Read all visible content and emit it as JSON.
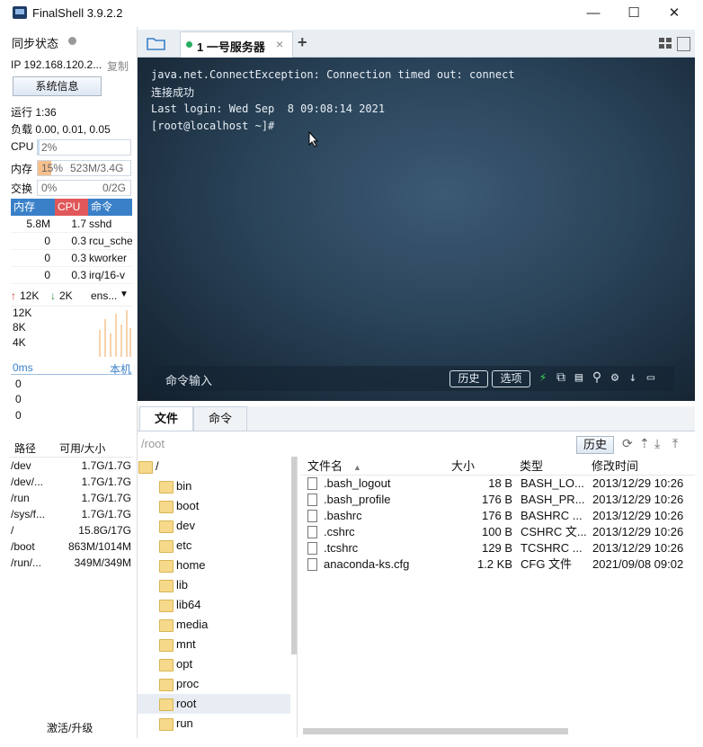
{
  "window": {
    "title": "FinalShell 3.9.2.2",
    "minimize": "—",
    "maximize": "☐",
    "close": "✕"
  },
  "left": {
    "sync_label": "同步状态",
    "ip": "IP 192.168.120.2...",
    "copy_label": "复制",
    "sysinfo_button": "系统信息",
    "uptime": "运行 1:36",
    "load": "负载 0.00, 0.01, 0.05",
    "cpu": {
      "label": "CPU",
      "value": "2%",
      "level": 0.02
    },
    "mem": {
      "label": "内存",
      "percent": "15%",
      "detail": "523M/3.4G",
      "level": 0.15
    },
    "swap": {
      "label": "交换",
      "percent": "0%",
      "detail": "0/2G",
      "level": 0
    },
    "process_headers": [
      "内存",
      "CPU",
      "命令"
    ],
    "processes": [
      {
        "mem": "5.8M",
        "cpu": "1.7",
        "cmd": "sshd"
      },
      {
        "mem": "0",
        "cpu": "0.3",
        "cmd": "rcu_sche"
      },
      {
        "mem": "0",
        "cpu": "0.3",
        "cmd": "kworker"
      },
      {
        "mem": "0",
        "cpu": "0.3",
        "cmd": "irq/16-v"
      }
    ],
    "net": {
      "up": "12K",
      "down": "2K",
      "iface": "ens...",
      "ticks": [
        "12K",
        "8K",
        "4K"
      ]
    },
    "latency": {
      "label": "0ms",
      "host": "本机",
      "ticks": [
        "0",
        "0",
        "0"
      ]
    },
    "disk_headers": [
      "路径",
      "可用/大小"
    ],
    "disks": [
      {
        "path": "/dev",
        "size": "1.7G/1.7G"
      },
      {
        "path": "/dev/...",
        "size": "1.7G/1.7G"
      },
      {
        "path": "/run",
        "size": "1.7G/1.7G"
      },
      {
        "path": "/sys/f...",
        "size": "1.7G/1.7G"
      },
      {
        "path": "/",
        "size": "15.8G/17G"
      },
      {
        "path": "/boot",
        "size": "863M/1014M"
      },
      {
        "path": "/run/...",
        "size": "349M/349M"
      }
    ],
    "activate": "激活/升级"
  },
  "tabs": {
    "active_label": "1 一号服务器",
    "close": "×",
    "add": "+"
  },
  "terminal": {
    "lines": [
      "java.net.ConnectException: Connection timed out: connect",
      "连接成功",
      "Last login: Wed Sep  8 09:08:14 2021",
      "[root@localhost ~]#"
    ],
    "cmd_placeholder": "命令输入",
    "history_button": "历史",
    "options_button": "选项"
  },
  "filemgr": {
    "tabs": [
      "文件",
      "命令"
    ],
    "path": "/root",
    "history_button": "历史",
    "tree": [
      "/",
      "bin",
      "boot",
      "dev",
      "etc",
      "home",
      "lib",
      "lib64",
      "media",
      "mnt",
      "opt",
      "proc",
      "root",
      "run"
    ],
    "columns": [
      "文件名",
      "大小",
      "类型",
      "修改时间"
    ],
    "files": [
      {
        "name": ".bash_logout",
        "size": "18 B",
        "type": "BASH_LO...",
        "mtime": "2013/12/29 10:26"
      },
      {
        "name": ".bash_profile",
        "size": "176 B",
        "type": "BASH_PR...",
        "mtime": "2013/12/29 10:26"
      },
      {
        "name": ".bashrc",
        "size": "176 B",
        "type": "BASHRC ...",
        "mtime": "2013/12/29 10:26"
      },
      {
        "name": ".cshrc",
        "size": "100 B",
        "type": "CSHRC 文...",
        "mtime": "2013/12/29 10:26"
      },
      {
        "name": ".tcshrc",
        "size": "129 B",
        "type": "TCSHRC ...",
        "mtime": "2013/12/29 10:26"
      },
      {
        "name": "anaconda-ks.cfg",
        "size": "1.2 KB",
        "type": "CFG 文件",
        "mtime": "2021/09/08 09:02"
      }
    ]
  }
}
